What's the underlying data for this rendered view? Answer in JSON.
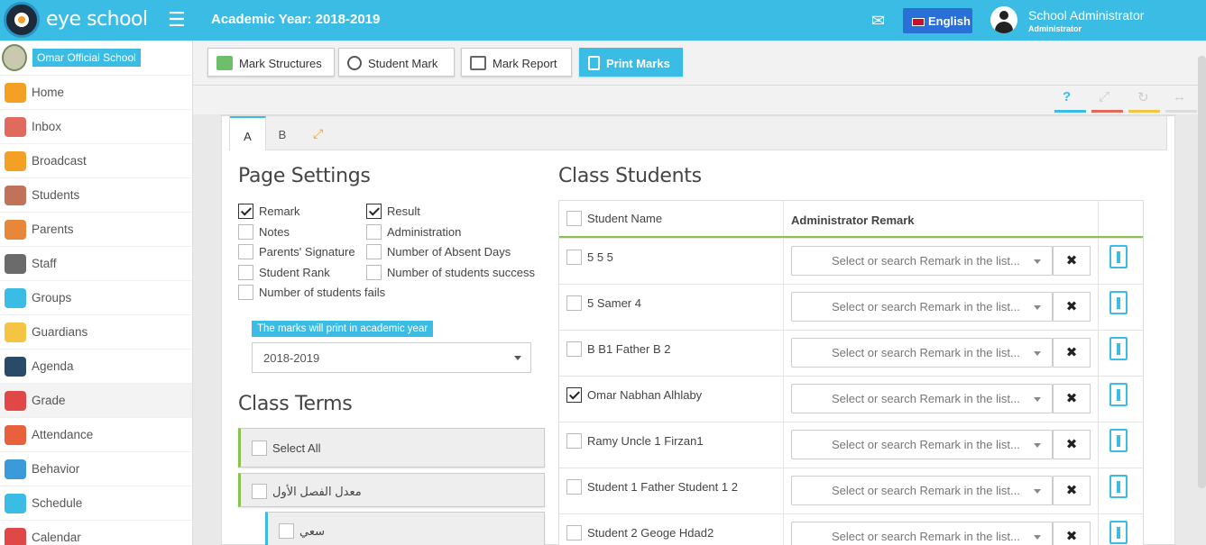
{
  "header": {
    "brand": "eye school",
    "academic_year": "Academic Year: 2018-2019",
    "language": "English",
    "user_name": "School Administrator",
    "user_role": "Administrator"
  },
  "sidebar": {
    "school": "Omar Official School",
    "items": [
      {
        "label": "Home",
        "icon": "home-icon",
        "color": "#f4a024"
      },
      {
        "label": "Inbox",
        "icon": "inbox-icon",
        "color": "#e06b5c"
      },
      {
        "label": "Broadcast",
        "icon": "broadcast-icon",
        "color": "#f4a024"
      },
      {
        "label": "Students",
        "icon": "students-icon",
        "color": "#c0725a"
      },
      {
        "label": "Parents",
        "icon": "parents-icon",
        "color": "#e8873a"
      },
      {
        "label": "Staff",
        "icon": "staff-icon",
        "color": "#6b6b6b"
      },
      {
        "label": "Groups",
        "icon": "groups-icon",
        "color": "#3bbce5"
      },
      {
        "label": "Guardians",
        "icon": "guardians-icon",
        "color": "#f4c542"
      },
      {
        "label": "Agenda",
        "icon": "agenda-icon",
        "color": "#2a4a6a"
      },
      {
        "label": "Grade",
        "icon": "grade-icon",
        "color": "#e04848"
      },
      {
        "label": "Attendance",
        "icon": "attendance-icon",
        "color": "#e8603c"
      },
      {
        "label": "Behavior",
        "icon": "behavior-icon",
        "color": "#3b9ad9"
      },
      {
        "label": "Schedule",
        "icon": "schedule-icon",
        "color": "#3bbce5"
      },
      {
        "label": "Calendar",
        "icon": "calendar-icon",
        "color": "#e04848"
      }
    ]
  },
  "toolbar": {
    "mark_structures": "Mark Structures",
    "student_mark": "Student Mark",
    "mark_report": "Mark Report",
    "print_marks": "Print Marks"
  },
  "tabs": {
    "a": "A",
    "b": "B"
  },
  "page_settings": {
    "title": "Page Settings",
    "options": [
      {
        "label": "Remark",
        "checked": true
      },
      {
        "label": "Result",
        "checked": true
      },
      {
        "label": "Notes",
        "checked": false
      },
      {
        "label": "Administration",
        "checked": false
      },
      {
        "label": "Parents' Signature",
        "checked": false
      },
      {
        "label": "Number of Absent Days",
        "checked": false
      },
      {
        "label": "Student Rank",
        "checked": false
      },
      {
        "label": "Number of students success",
        "checked": false
      },
      {
        "label": "Number of students fails",
        "checked": false
      }
    ],
    "year_note": "The marks will print in academic year",
    "year_value": "2018-2019"
  },
  "class_terms": {
    "title": "Class Terms",
    "select_all": "Select All",
    "term_1": "معدل الفصل الأول",
    "sub_1": "سعي"
  },
  "class_students": {
    "title": "Class Students",
    "col_name": "Student Name",
    "col_remark": "Administrator Remark",
    "remark_placeholder": "Select or search Remark in the list...",
    "rows": [
      {
        "name": "5 5 5",
        "checked": false
      },
      {
        "name": "5 Samer 4",
        "checked": false
      },
      {
        "name": "B B1 Father B 2",
        "checked": false
      },
      {
        "name": "Omar Nabhan Alhlaby",
        "checked": true
      },
      {
        "name": "Ramy Uncle 1 Firzan1",
        "checked": false
      },
      {
        "name": "Student 1 Father Student 1 2",
        "checked": false
      },
      {
        "name": "Student 2 Geoge Hdad2",
        "checked": false
      }
    ]
  },
  "colors": {
    "accent": "#3bbce5",
    "green": "#8cc152",
    "orange": "#f4a024"
  }
}
